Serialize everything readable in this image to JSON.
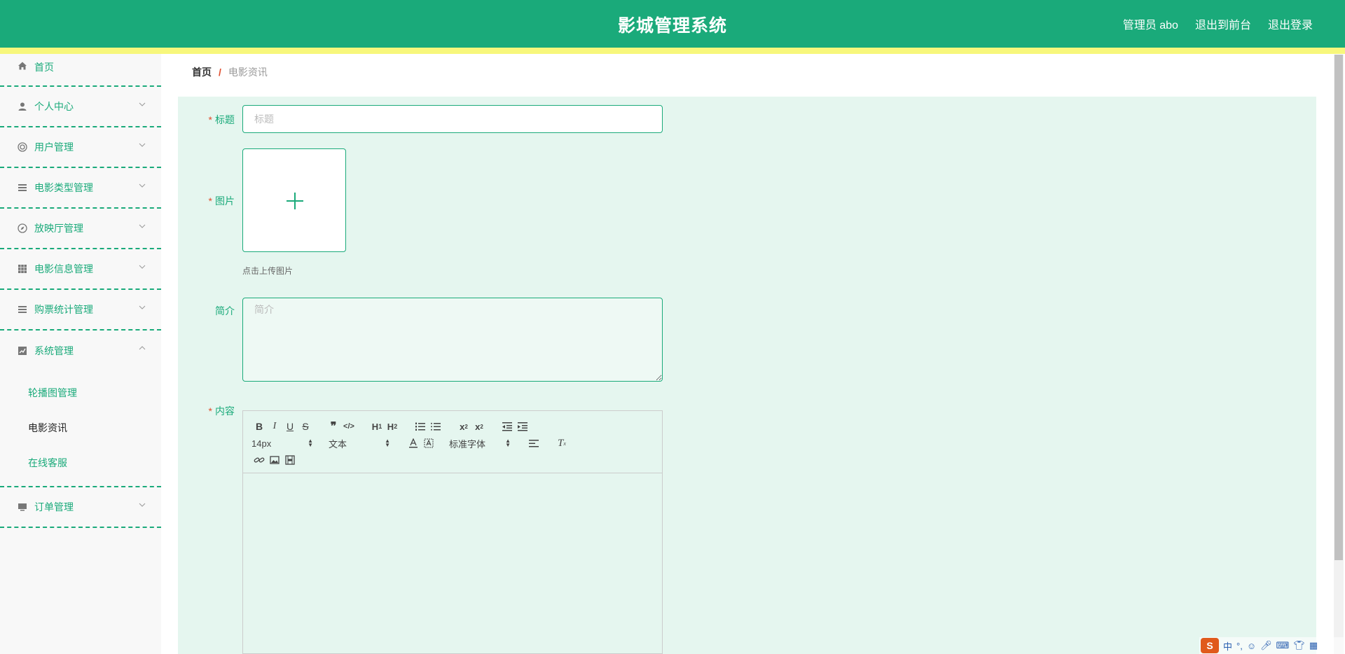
{
  "header": {
    "title": "影城管理系统",
    "admin_label": "管理员 abo",
    "exit_front_label": "退出到前台",
    "logout_label": "退出登录"
  },
  "sidebar": {
    "items": [
      {
        "label": "首页",
        "icon": "home-icon"
      },
      {
        "label": "个人中心",
        "icon": "user-icon"
      },
      {
        "label": "用户管理",
        "icon": "lifebuoy-icon"
      },
      {
        "label": "电影类型管理",
        "icon": "list-icon"
      },
      {
        "label": "放映厅管理",
        "icon": "compass-icon"
      },
      {
        "label": "电影信息管理",
        "icon": "grid-icon"
      },
      {
        "label": "购票统计管理",
        "icon": "list-icon"
      },
      {
        "label": "系统管理",
        "icon": "chart-icon"
      },
      {
        "label": "订单管理",
        "icon": "monitor-icon"
      }
    ],
    "system_sub": [
      "轮播图管理",
      "电影资讯",
      "在线客服"
    ]
  },
  "breadcrumb": {
    "home": "首页",
    "separator": "/",
    "current": "电影资讯"
  },
  "form": {
    "title_label": "标题",
    "title_placeholder": "标题",
    "image_label": "图片",
    "upload_hint": "点击上传图片",
    "intro_label": "简介",
    "intro_placeholder": "简介",
    "content_label": "内容",
    "required_mark": "*"
  },
  "editor": {
    "font_size": "14px",
    "header_select": "文本",
    "font_family": "标准字体",
    "buttons_row1": [
      "B",
      "I",
      "U",
      "S",
      "❞",
      "</>",
      "H1",
      "H2",
      "ol",
      "ul",
      "x₂",
      "x²",
      "outdent",
      "indent"
    ],
    "buttons_row2": [
      "color",
      "background",
      "align",
      "clear"
    ],
    "buttons_row3": [
      "link",
      "image",
      "video"
    ]
  },
  "ime": {
    "logo": "S",
    "mode": "中",
    "punct": "°,"
  },
  "colors": {
    "brand": "#1aaa7a",
    "strip": "#f7f77c",
    "content_bg": "#e5f6ef",
    "required": "#e04c2c"
  }
}
